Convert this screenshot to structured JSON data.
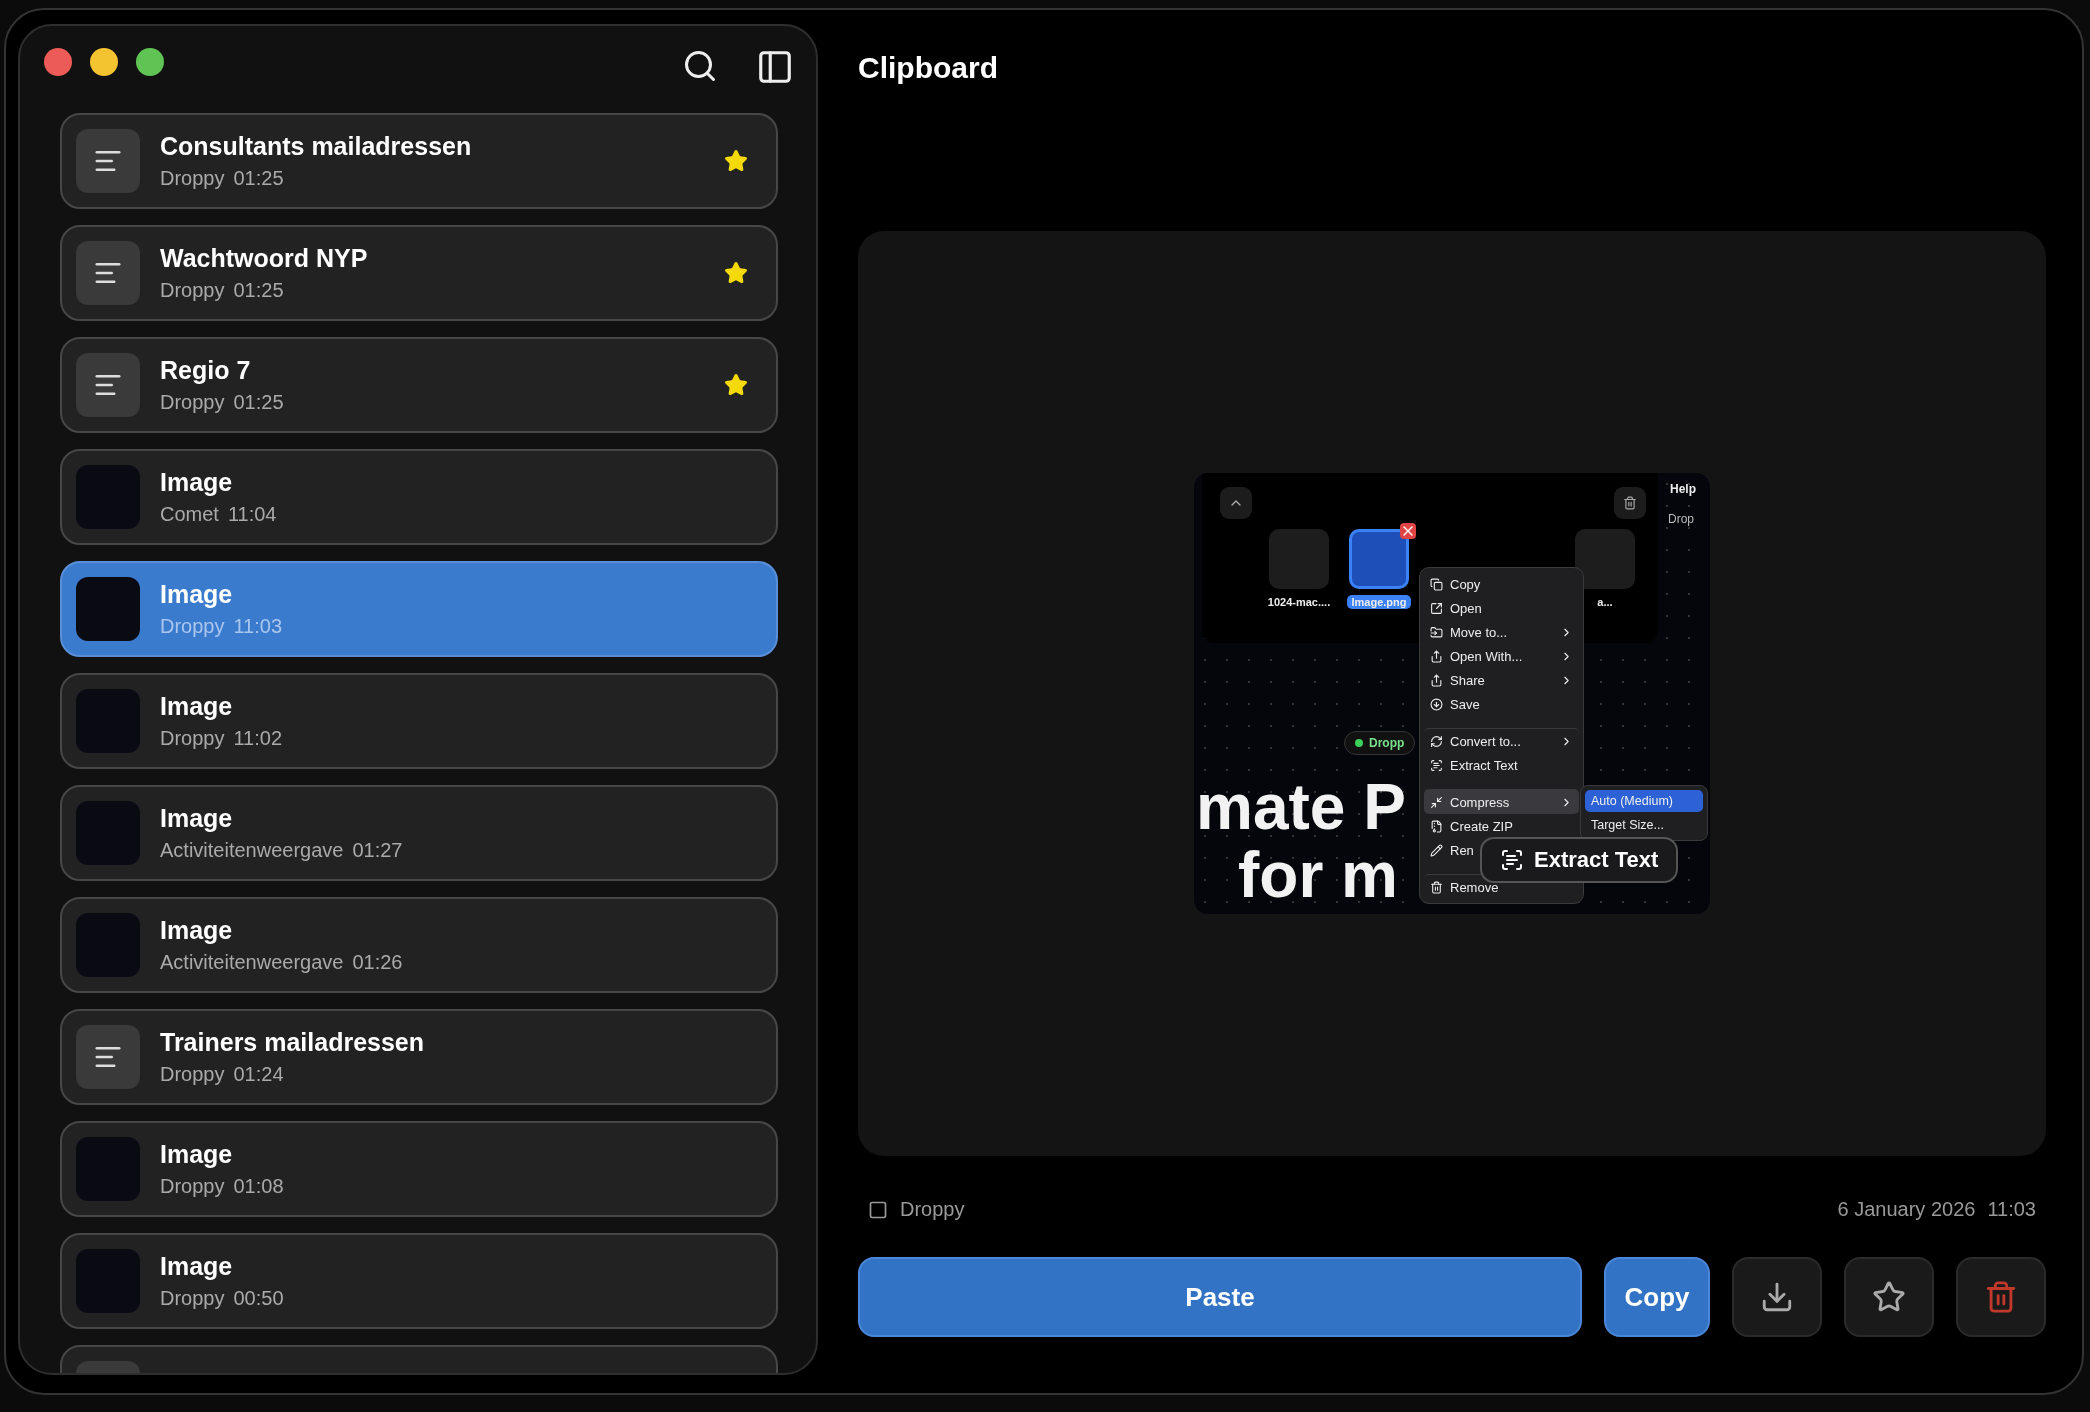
{
  "sidebar": {
    "items": [
      {
        "kind": "text",
        "title": "Consultants mailadressen",
        "source": "Droppy",
        "time": "01:25",
        "starred": true,
        "selected": false
      },
      {
        "kind": "text",
        "title": "Wachtwoord NYP",
        "source": "Droppy",
        "time": "01:25",
        "starred": true,
        "selected": false
      },
      {
        "kind": "text",
        "title": "Regio 7",
        "source": "Droppy",
        "time": "01:25",
        "starred": true,
        "selected": false
      },
      {
        "kind": "image",
        "title": "Image",
        "source": "Comet",
        "time": "11:04",
        "starred": false,
        "selected": false
      },
      {
        "kind": "image",
        "title": "Image",
        "source": "Droppy",
        "time": "11:03",
        "starred": false,
        "selected": true
      },
      {
        "kind": "image",
        "title": "Image",
        "source": "Droppy",
        "time": "11:02",
        "starred": false,
        "selected": false
      },
      {
        "kind": "image",
        "title": "Image",
        "source": "Activiteitenweergave",
        "time": "01:27",
        "starred": false,
        "selected": false
      },
      {
        "kind": "image",
        "title": "Image",
        "source": "Activiteitenweergave",
        "time": "01:26",
        "starred": false,
        "selected": false
      },
      {
        "kind": "text",
        "title": "Trainers mailadressen",
        "source": "Droppy",
        "time": "01:24",
        "starred": false,
        "selected": false
      },
      {
        "kind": "image",
        "title": "Image",
        "source": "Droppy",
        "time": "01:08",
        "starred": false,
        "selected": false
      },
      {
        "kind": "image",
        "title": "Image",
        "source": "Droppy",
        "time": "00:50",
        "starred": false,
        "selected": false
      },
      {
        "kind": "text",
        "starred": false,
        "selected": false
      }
    ]
  },
  "main": {
    "title": "Clipboard",
    "preview": {
      "top_right": "Help",
      "side_label": "Drop",
      "pill": "Dropp",
      "headline": [
        "mate P",
        "for m"
      ],
      "files": [
        {
          "name": "1024-mac....",
          "selected": false
        },
        {
          "name": "Image.png",
          "selected": true
        },
        {
          "name": "a...",
          "selected": false
        }
      ],
      "menu": [
        {
          "label": "Copy",
          "submenu": false,
          "highlighted": false,
          "divider_before": false
        },
        {
          "label": "Open",
          "submenu": false,
          "highlighted": false,
          "divider_before": false
        },
        {
          "label": "Move to...",
          "submenu": true,
          "highlighted": false,
          "divider_before": false
        },
        {
          "label": "Open With...",
          "submenu": true,
          "highlighted": false,
          "divider_before": false
        },
        {
          "label": "Share",
          "submenu": true,
          "highlighted": false,
          "divider_before": false
        },
        {
          "label": "Save",
          "submenu": false,
          "highlighted": false,
          "divider_before": false
        },
        {
          "label": "Convert to...",
          "submenu": true,
          "highlighted": false,
          "divider_before": true
        },
        {
          "label": "Extract Text",
          "submenu": false,
          "highlighted": false,
          "divider_before": false
        },
        {
          "label": "Compress",
          "submenu": true,
          "highlighted": true,
          "divider_before": true
        },
        {
          "label": "Create ZIP",
          "submenu": false,
          "highlighted": false,
          "divider_before": false
        },
        {
          "label": "Ren",
          "highlighted": false,
          "divider_before": false
        },
        {
          "label": "Remove",
          "submenu": false,
          "highlighted": false,
          "divider_before": true
        }
      ],
      "submenu": [
        {
          "label": "Auto (Medium)",
          "selected": true
        },
        {
          "label": "Target Size...",
          "selected": false
        }
      ],
      "tooltip": "Extract Text"
    },
    "source": "Droppy",
    "date": "6 January 2026",
    "time": "11:03",
    "buttons": {
      "paste": "Paste",
      "copy": "Copy"
    }
  }
}
